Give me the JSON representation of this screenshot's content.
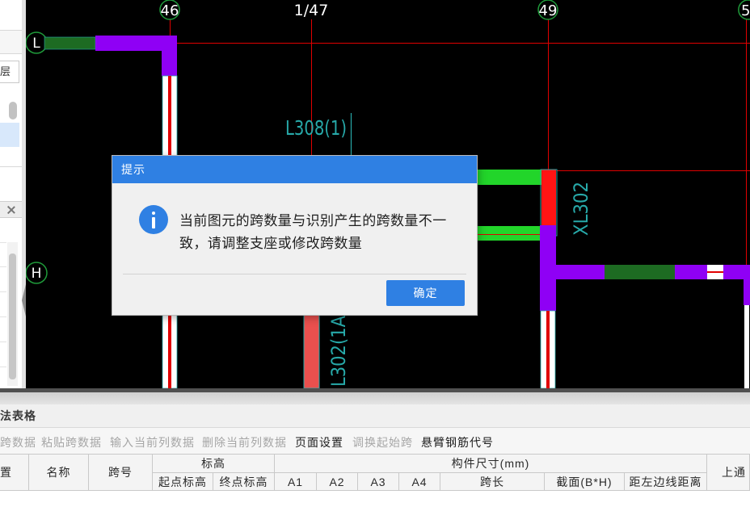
{
  "colors": {
    "cad_background": "#000000",
    "axis_line": "#e00000",
    "axis_bubble": "#1f9a3a",
    "beam_purple": "#8f00f5",
    "beam_green": "#22d52a",
    "beam_dark_green": "#1d6b22",
    "beam_red": "#ff1414",
    "beam_salmon": "#e9504e",
    "beam_white": "#ffffff",
    "label_teal": "#27a9a9",
    "dialog_accent": "#2f80e3",
    "toolbar_disabled": "#a6a6a6",
    "toolbar_enabled": "#1e1e1e"
  },
  "icons": {
    "dialog": "info-icon",
    "panel_close": "close-icon",
    "splitter": "collapse-arrow-icon"
  },
  "left_panel": {
    "floor_label": "层"
  },
  "cad": {
    "axis_top": [
      "46",
      "1/47",
      "49",
      "5"
    ],
    "axis_side": [
      "L",
      "H"
    ],
    "beam_labels": {
      "top": "L308(1)",
      "right": "XL302",
      "bottom": "L302(1A"
    }
  },
  "dialog": {
    "title": "提示",
    "message_lines": [
      "当前图元的跨数量与识别产生的跨数量不一",
      "致，请调整支座或修改跨数量"
    ],
    "ok_label": "确定"
  },
  "bottom_panel": {
    "title": "法表格",
    "toolbar": [
      {
        "label": "跨数据",
        "enabled": false
      },
      {
        "label": "粘贴跨数据",
        "enabled": false
      },
      {
        "label": "输入当前列数据",
        "enabled": false
      },
      {
        "label": "删除当前列数据",
        "enabled": false
      },
      {
        "label": "页面设置",
        "enabled": true
      },
      {
        "label": "调换起始跨",
        "enabled": false
      },
      {
        "label": "悬臂钢筋代号",
        "enabled": true
      }
    ],
    "table_header": {
      "position": "置",
      "name": "名称",
      "span_no": "跨号",
      "elevation": "标高",
      "elevation_start": "起点标高",
      "elevation_end": "终点标高",
      "dimensions": "构件尺寸(mm)",
      "dimension_columns": [
        "A1",
        "A2",
        "A3",
        "A4",
        "跨长",
        "截面(B*H)",
        "距左边线距离"
      ],
      "top_through": "上通"
    }
  }
}
